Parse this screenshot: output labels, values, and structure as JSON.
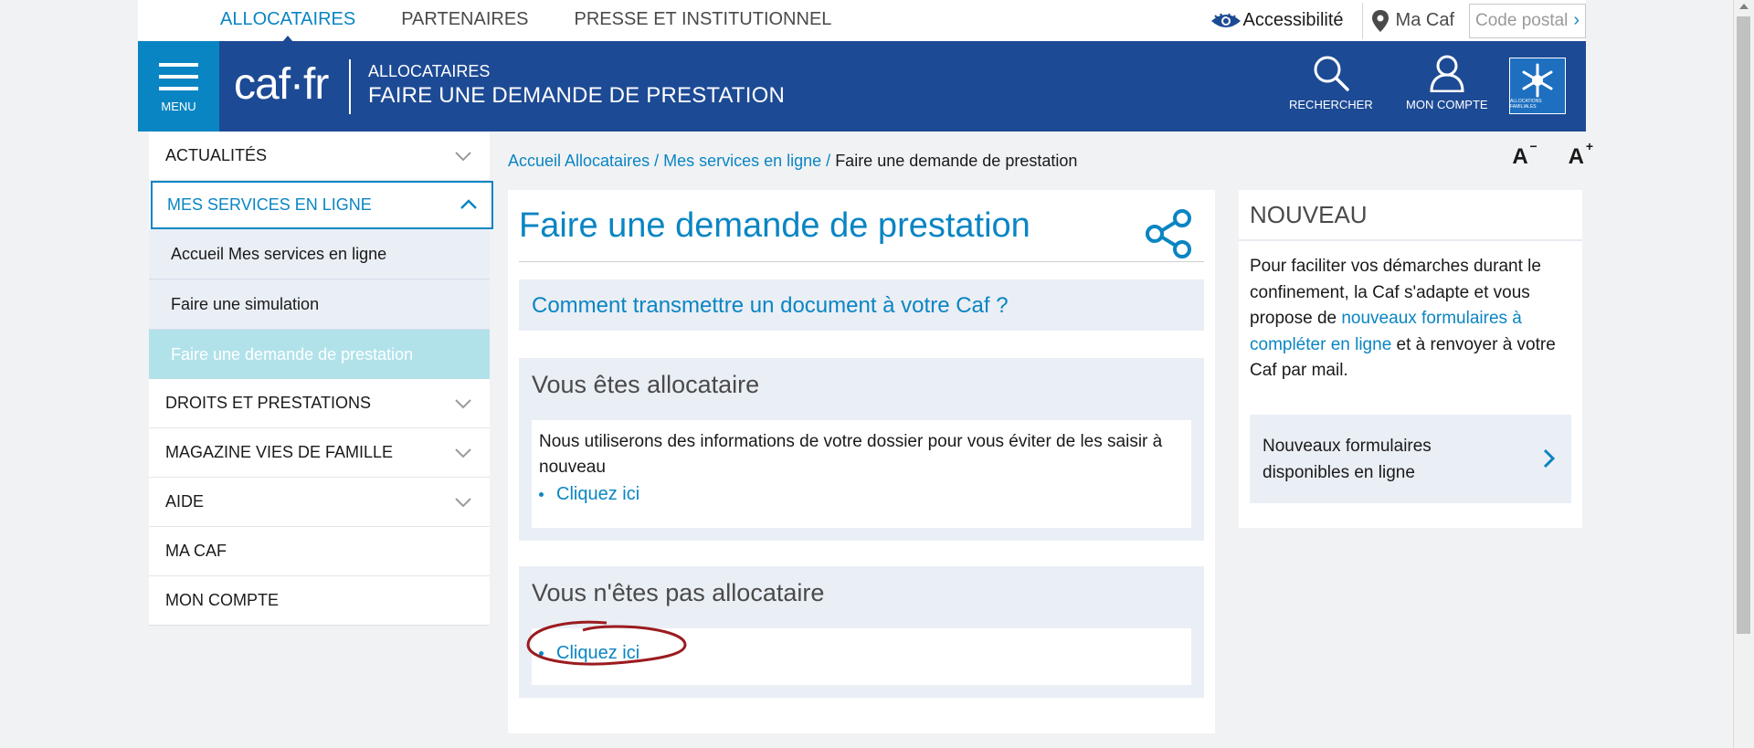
{
  "topnav": {
    "items": [
      {
        "label": "ALLOCATAIRES",
        "active": true
      },
      {
        "label": "PARTENAIRES",
        "active": false
      },
      {
        "label": "PRESSE ET INSTITUTIONNEL",
        "active": false
      }
    ],
    "accessibility_label": "Accessibilité",
    "macaf_label": "Ma Caf",
    "postal_placeholder": "Code postal",
    "postal_arrow": "›"
  },
  "header": {
    "menu_label": "MENU",
    "logo": "caf·fr",
    "section": "ALLOCATAIRES",
    "title": "FAIRE UNE DEMANDE DE PRESTATION",
    "search_label": "RECHERCHER",
    "account_label": "MON COMPTE",
    "emblem_text": "ALLOCATIONS FAMILIALES"
  },
  "sidebar": {
    "items": [
      {
        "label": "ACTUALITÉS",
        "chevron": true
      },
      {
        "label": "MES SERVICES EN LIGNE",
        "chevron": true,
        "open": true
      },
      {
        "label": "DROITS ET PRESTATIONS",
        "chevron": true
      },
      {
        "label": "MAGAZINE VIES DE FAMILLE",
        "chevron": true
      },
      {
        "label": "AIDE",
        "chevron": true
      },
      {
        "label": "MA CAF",
        "chevron": false
      },
      {
        "label": "MON COMPTE",
        "chevron": false
      }
    ],
    "subitems": [
      {
        "label": "Accueil Mes services en ligne"
      },
      {
        "label": "Faire une simulation"
      },
      {
        "label": "Faire une demande de prestation",
        "active": true
      }
    ]
  },
  "breadcrumb": {
    "home": "Accueil Allocataires",
    "sep": " / ",
    "parent": "Mes services en ligne",
    "current": "Faire une demande de prestation"
  },
  "fontsize": {
    "decrease": "A",
    "decrease_sup": "−",
    "increase": "A",
    "increase_sup": "+"
  },
  "main": {
    "title": "Faire une demande de prestation",
    "info_link": "Comment transmettre un document à votre Caf ?",
    "block1": {
      "heading": "Vous êtes allocataire",
      "text": "Nous utiliserons des informations de votre dossier pour vous éviter de les saisir à nouveau",
      "link": "Cliquez ici"
    },
    "block2": {
      "heading": "Vous n'êtes pas allocataire",
      "link": "Cliquez ici"
    }
  },
  "aside": {
    "heading": "NOUVEAU",
    "text_before": "Pour faciliter vos démarches durant le confinement, la Caf s'adapte et vous propose de ",
    "text_link": "nouveaux formulaires à compléter en ligne",
    "text_after": " et à renvoyer à votre Caf par mail.",
    "button_label": "Nouveaux formulaires disponibles en ligne"
  },
  "colors": {
    "brand_blue": "#1d4a94",
    "accent": "#0a85c3",
    "annotation": "#9b1b1f"
  }
}
